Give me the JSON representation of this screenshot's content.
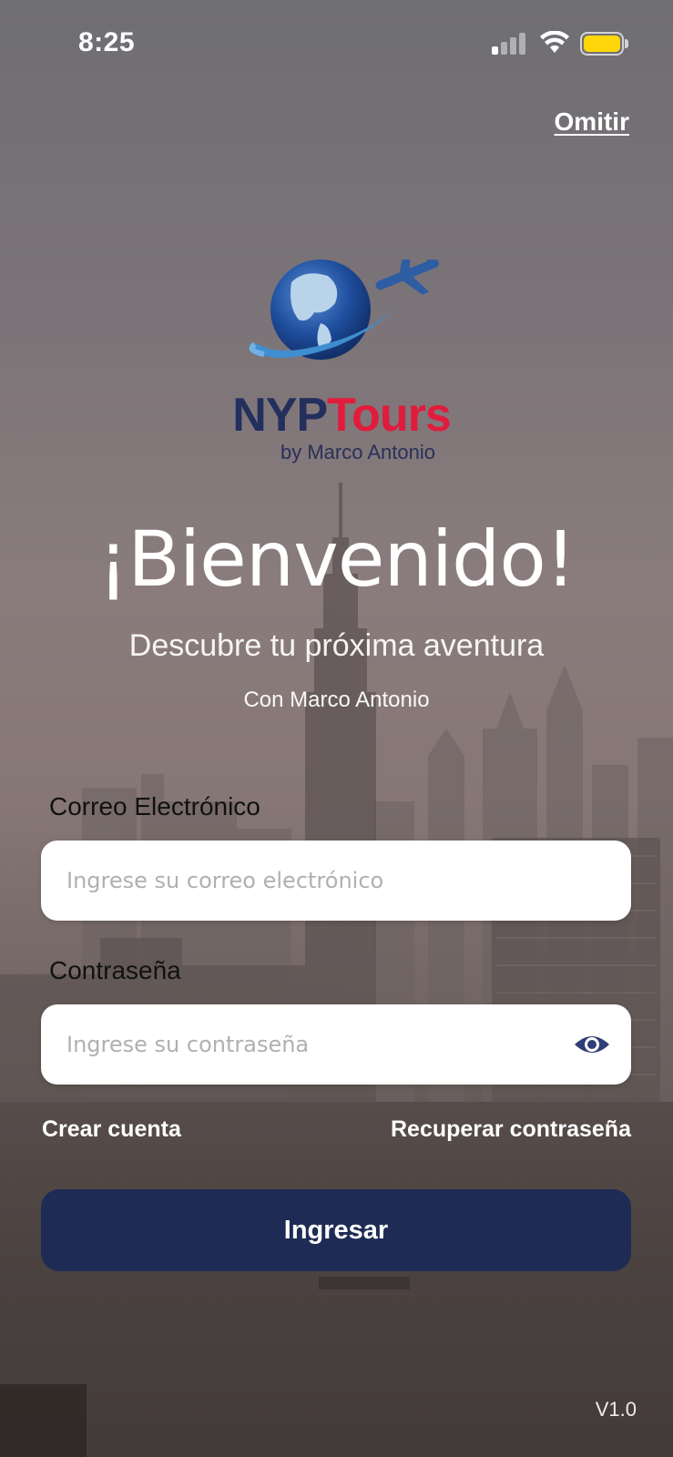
{
  "status_bar": {
    "time": "8:25",
    "signal_icon": "cellular-signal-icon",
    "wifi_icon": "wifi-icon",
    "battery_icon": "battery-icon",
    "battery_color": "#ffd60a"
  },
  "header": {
    "skip_label": "Omitir"
  },
  "brand": {
    "name_part1": "NYP",
    "name_part2": "Tours",
    "subtitle": "by Marco Antonio",
    "color_primary": "#23305d",
    "color_accent": "#e11b3c"
  },
  "hero": {
    "title": "¡Bienvenido!",
    "tagline": "Descubre tu próxima aventura",
    "byline": "Con Marco Antonio"
  },
  "form": {
    "email": {
      "label": "Correo Electrónico",
      "placeholder": "Ingrese su correo electrónico",
      "value": ""
    },
    "password": {
      "label": "Contraseña",
      "placeholder": "Ingrese su contraseña",
      "value": "",
      "toggle_icon": "eye-icon"
    },
    "create_account_label": "Crear cuenta",
    "recover_password_label": "Recuperar contraseña",
    "submit_label": "Ingresar",
    "submit_color": "#1e2b55"
  },
  "footer": {
    "version": "V1.0"
  }
}
